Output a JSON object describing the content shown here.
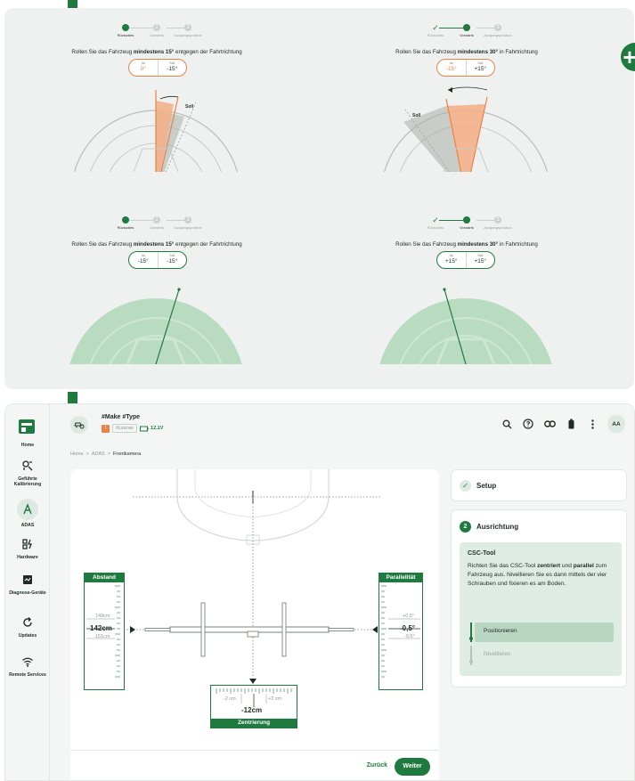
{
  "colors": {
    "brand": "#1e7a3e",
    "orange": "#e8834b",
    "light_green": "#dfece4"
  },
  "steps": {
    "labels": [
      "Rückwärts",
      "Vorwärts",
      "Ausgangsposition"
    ]
  },
  "cards": [
    {
      "instr_pre": "Rollen Sie das Fahrzeug ",
      "instr_bold": "mindestens 15°",
      "instr_post": " entgegen der Fahrtrichtung",
      "ist_label": "Ist",
      "soll_label": "Soll",
      "ist": "0°",
      "soll": "-15°",
      "soll_tag": "Soll"
    },
    {
      "instr_pre": "Rollen Sie das Fahrzeug ",
      "instr_bold": "mindestens 30°",
      "instr_post": " in Fahrtrichtung",
      "ist_label": "Ist",
      "soll_label": "Soll",
      "ist": "-15°",
      "soll": "+15°",
      "soll_tag": "Soll"
    },
    {
      "instr_pre": "Rollen Sie das Fahrzeug ",
      "instr_bold": "mindestens 15°",
      "instr_post": " entgegen der Fahrtrichtung",
      "ist_label": "Ist",
      "soll_label": "Soll",
      "ist": "-15°",
      "soll": "-15°"
    },
    {
      "instr_pre": "Rollen Sie das Fahrzeug ",
      "instr_bold": "mindestens 30°",
      "instr_post": " in Fahrtrichtung",
      "ist_label": "Ist",
      "soll_label": "Soll",
      "ist": "+15°",
      "soll": "+15°"
    }
  ],
  "sidebar": {
    "items": [
      {
        "label": "Home",
        "icon": "home-icon"
      },
      {
        "label": "Geführte Kalibrierung",
        "icon": "calibration-icon"
      },
      {
        "label": "ADAS",
        "icon": "adas-icon"
      },
      {
        "label": "Hardware",
        "icon": "hardware-icon"
      },
      {
        "label": "Diagnose-Geräte",
        "icon": "diagnostic-device-icon"
      },
      {
        "label": "Updates",
        "icon": "updates-icon"
      },
      {
        "label": "Remote Services",
        "icon": "wifi-icon"
      }
    ]
  },
  "header": {
    "vehicle": "#Make #Type",
    "license": "#Lizense",
    "battery": "12.1V",
    "avatar": "AA"
  },
  "breadcrumb": {
    "home": "Home",
    "adas": "ADAS",
    "current": "Frontkamera",
    "sep": ">"
  },
  "gauges": {
    "distance": {
      "title": "Abstand",
      "upper": "149cm",
      "value": "142cm",
      "lower": "151cm"
    },
    "parallel": {
      "title": "Parallelität",
      "upper": "+0,5°",
      "value": "-0,5°",
      "lower": "-0,5°"
    },
    "center": {
      "title": "Zentrierung",
      "left": "-2 cm",
      "right": "+2 cm",
      "value": "-12cm"
    }
  },
  "footer": {
    "back": "Zurück",
    "next": "Weiter"
  },
  "panel": {
    "setup_title": "Setup",
    "step_number": "2",
    "align_title": "Ausrichtung",
    "tool_title": "CSC-Tool",
    "desc_1": "Richten Sie das CSC-Tool ",
    "desc_b1": "zentriert",
    "desc_2": " und ",
    "desc_b2": "parallel",
    "desc_3": " zum Fahrzeug aus. Nivellieren Sie es dann mittels der vier Schrauben und fixieren es am Boden.",
    "substeps": [
      "Positionieren",
      "Nivellieren"
    ]
  }
}
